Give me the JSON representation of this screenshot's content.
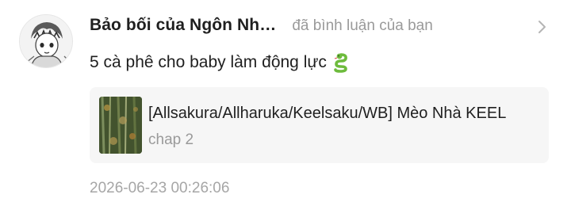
{
  "notification": {
    "avatar_icon": "user-avatar-icon",
    "username": "Bảo bối của Ngôn Nh…",
    "action": "đã bình luận của bạn",
    "chevron_icon": "chevron-right-icon",
    "message": "5 cà phê cho baby làm động lực",
    "message_emoji": "snake-emoji-icon",
    "card": {
      "thumbnail_icon": "comic-cover-thumbnail",
      "title": "[Allsakura/Allharuka/Keelsaku/WB] Mèo Nhà KEEL",
      "subtitle": "chap 2"
    },
    "timestamp": "2026-06-23 00:26:06"
  },
  "colors": {
    "primary_text": "#1f1f1f",
    "secondary_text": "#9a9a9a",
    "card_background": "#f6f6f6",
    "emoji_green": "#7cc242"
  }
}
